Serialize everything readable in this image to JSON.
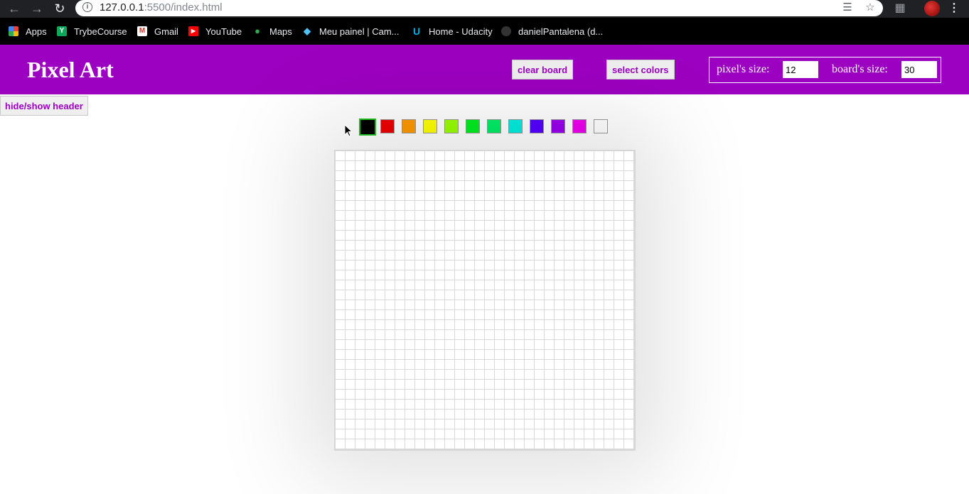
{
  "browser": {
    "url_host": "127.0.0.1",
    "url_rest": ":5500/index.html",
    "bookmarks": [
      {
        "label": "Apps",
        "icon": "apps-grid-icon",
        "color": "#ea4335"
      },
      {
        "label": "TrybeCourse",
        "icon": "trybe-icon",
        "color": "#0ea85a"
      },
      {
        "label": "Gmail",
        "icon": "gmail-icon",
        "color": "#d93025"
      },
      {
        "label": "YouTube",
        "icon": "youtube-icon",
        "color": "#ff0000"
      },
      {
        "label": "Maps",
        "icon": "maps-icon",
        "color": "#34a853"
      },
      {
        "label": "Meu painel | Cam...",
        "icon": "diamond-icon",
        "color": "#4fc3f7"
      },
      {
        "label": "Home - Udacity",
        "icon": "udacity-icon",
        "color": "#02b3e4"
      },
      {
        "label": "danielPantalena (d...",
        "icon": "github-icon",
        "color": "#555555"
      }
    ]
  },
  "app": {
    "title": "Pixel Art",
    "accent_color": "#9c00c0",
    "clear_button": "clear board",
    "select_colors_button": "select colors",
    "pixel_size_label": "pixel's size:",
    "pixel_size_value": "12",
    "board_size_label": "board's size:",
    "board_size_value": "30",
    "toggle_header_button": "hide/show header"
  },
  "palette": {
    "selected_index": 0,
    "colors": [
      "#000000",
      "#ee0000",
      "#ff9900",
      "#ffff00",
      "#99ff00",
      "#00ee22",
      "#00ee66",
      "#00eedd",
      "#5500ff",
      "#9900ee",
      "#ee00ee",
      "#ffffff"
    ]
  },
  "board": {
    "rows": 30,
    "columns": 30
  }
}
